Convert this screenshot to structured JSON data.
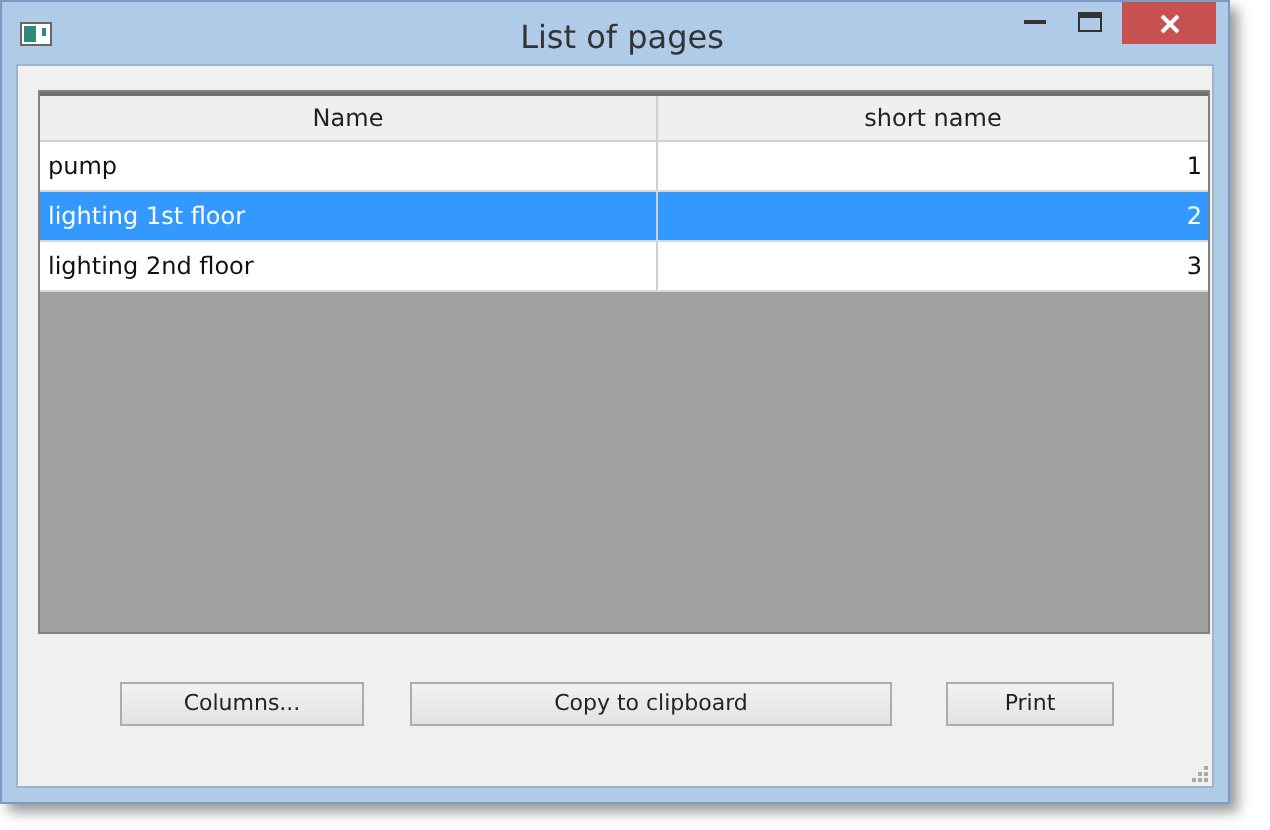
{
  "window": {
    "title": "List of pages"
  },
  "table": {
    "columns": [
      "Name",
      "short name"
    ],
    "rows": [
      {
        "cells": [
          "pump",
          "1"
        ],
        "selected": false
      },
      {
        "cells": [
          "lighting 1st floor",
          "2"
        ],
        "selected": true
      },
      {
        "cells": [
          "lighting 2nd floor",
          "3"
        ],
        "selected": false
      }
    ]
  },
  "buttons": [
    "Columns...",
    "Copy to clipboard",
    "Print"
  ]
}
